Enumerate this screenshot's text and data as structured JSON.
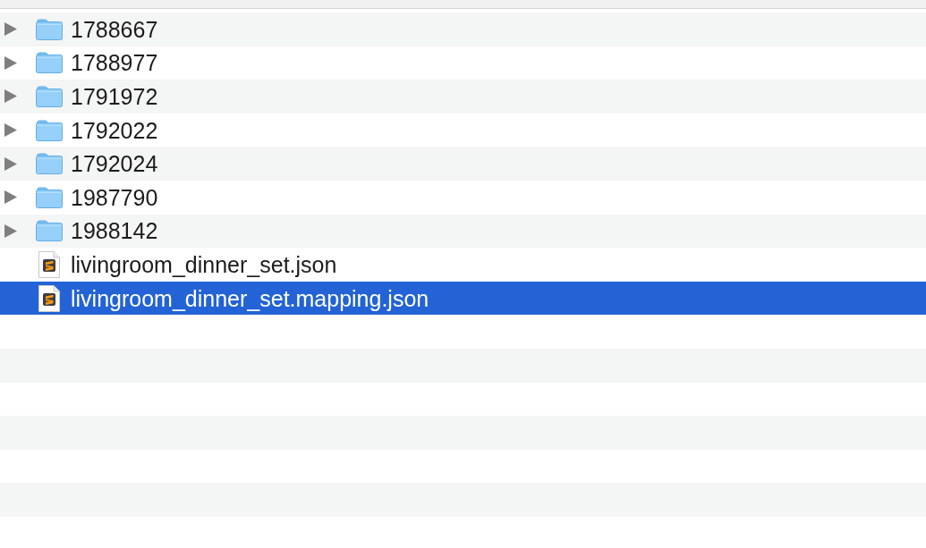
{
  "items": [
    {
      "name": "1788667",
      "kind": "folder",
      "expanded": false,
      "selected": false
    },
    {
      "name": "1788977",
      "kind": "folder",
      "expanded": false,
      "selected": false
    },
    {
      "name": "1791972",
      "kind": "folder",
      "expanded": false,
      "selected": false
    },
    {
      "name": "1792022",
      "kind": "folder",
      "expanded": false,
      "selected": false
    },
    {
      "name": "1792024",
      "kind": "folder",
      "expanded": false,
      "selected": false
    },
    {
      "name": "1987790",
      "kind": "folder",
      "expanded": false,
      "selected": false
    },
    {
      "name": "1988142",
      "kind": "folder",
      "expanded": false,
      "selected": false
    },
    {
      "name": "livingroom_dinner_set.json",
      "kind": "file",
      "selected": false
    },
    {
      "name": "livingroom_dinner_set.mapping.json",
      "kind": "file",
      "selected": true
    }
  ]
}
